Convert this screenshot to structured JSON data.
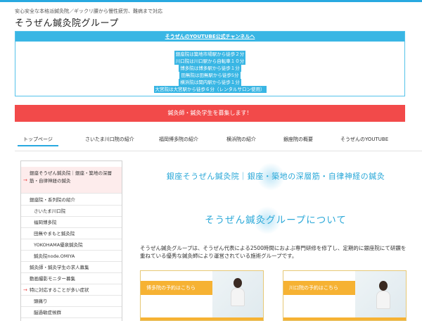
{
  "header": {
    "tagline": "安心安全な本格派鍼灸院／ギックリ腰から慢性疲労、難病まで対応",
    "site_title": "そうぜん鍼灸院グループ"
  },
  "info_box": {
    "youtube_link": "そうぜんのYOUTUBE公式チャンネルへ",
    "access": [
      "銀座院は築地市場駅から徒歩２分",
      "川口院は川口駅から自転車１０分",
      "博多院は博多駅から徒歩１分",
      "田無院は田無駅から徒歩5分",
      "横浜院は関内駅から徒歩１分",
      "大宮院は大宮駅から徒歩６分（レンタルサロン使用）"
    ]
  },
  "recruit_banner": "鍼灸師・鍼灸学生を募集します！",
  "nav": {
    "items": [
      "トップページ",
      "さいたま川口院の紹介",
      "福岡博多院の紹介",
      "横浜院の紹介",
      "銀座院の概要",
      "そうぜんのYOUTUBE"
    ]
  },
  "sidebar": {
    "items": [
      "銀座そうぜん鍼灸院｜銀座・築地の深層筋・自律神経の鍼灸",
      "銀座院・系列院の紹介",
      "さいたま川口院",
      "福岡博多院",
      "田無やまもと鍼灸院",
      "YOKOHAMA優泉鍼灸院",
      "鍼灸院node.OMIYA",
      "鍼灸師・鍼灸学生の求人募集",
      "動画撮影モニター募集",
      "特に対応することが多い症状",
      "頭痛り",
      "脳過敏症候群"
    ]
  },
  "main": {
    "heading": "銀座そうぜん鍼灸院｜銀座・築地の深層筋・自律神経の鍼灸",
    "subheading": "そうぜん鍼灸グループについて",
    "intro": "そうぜん鍼灸グループは、そうぜん代表による2500時間におよぶ専門研修を修了し、定期的に銀座院にて研鑽を重ねている優秀な鍼灸師により運営されている施術グループです。",
    "cards": [
      "博多院の予約はこちら",
      "川口院の予約はこちら"
    ]
  },
  "colors": {
    "accent_blue": "#39b6e4",
    "recruit_red": "#f24a4a",
    "card_orange": "#f6b233"
  }
}
